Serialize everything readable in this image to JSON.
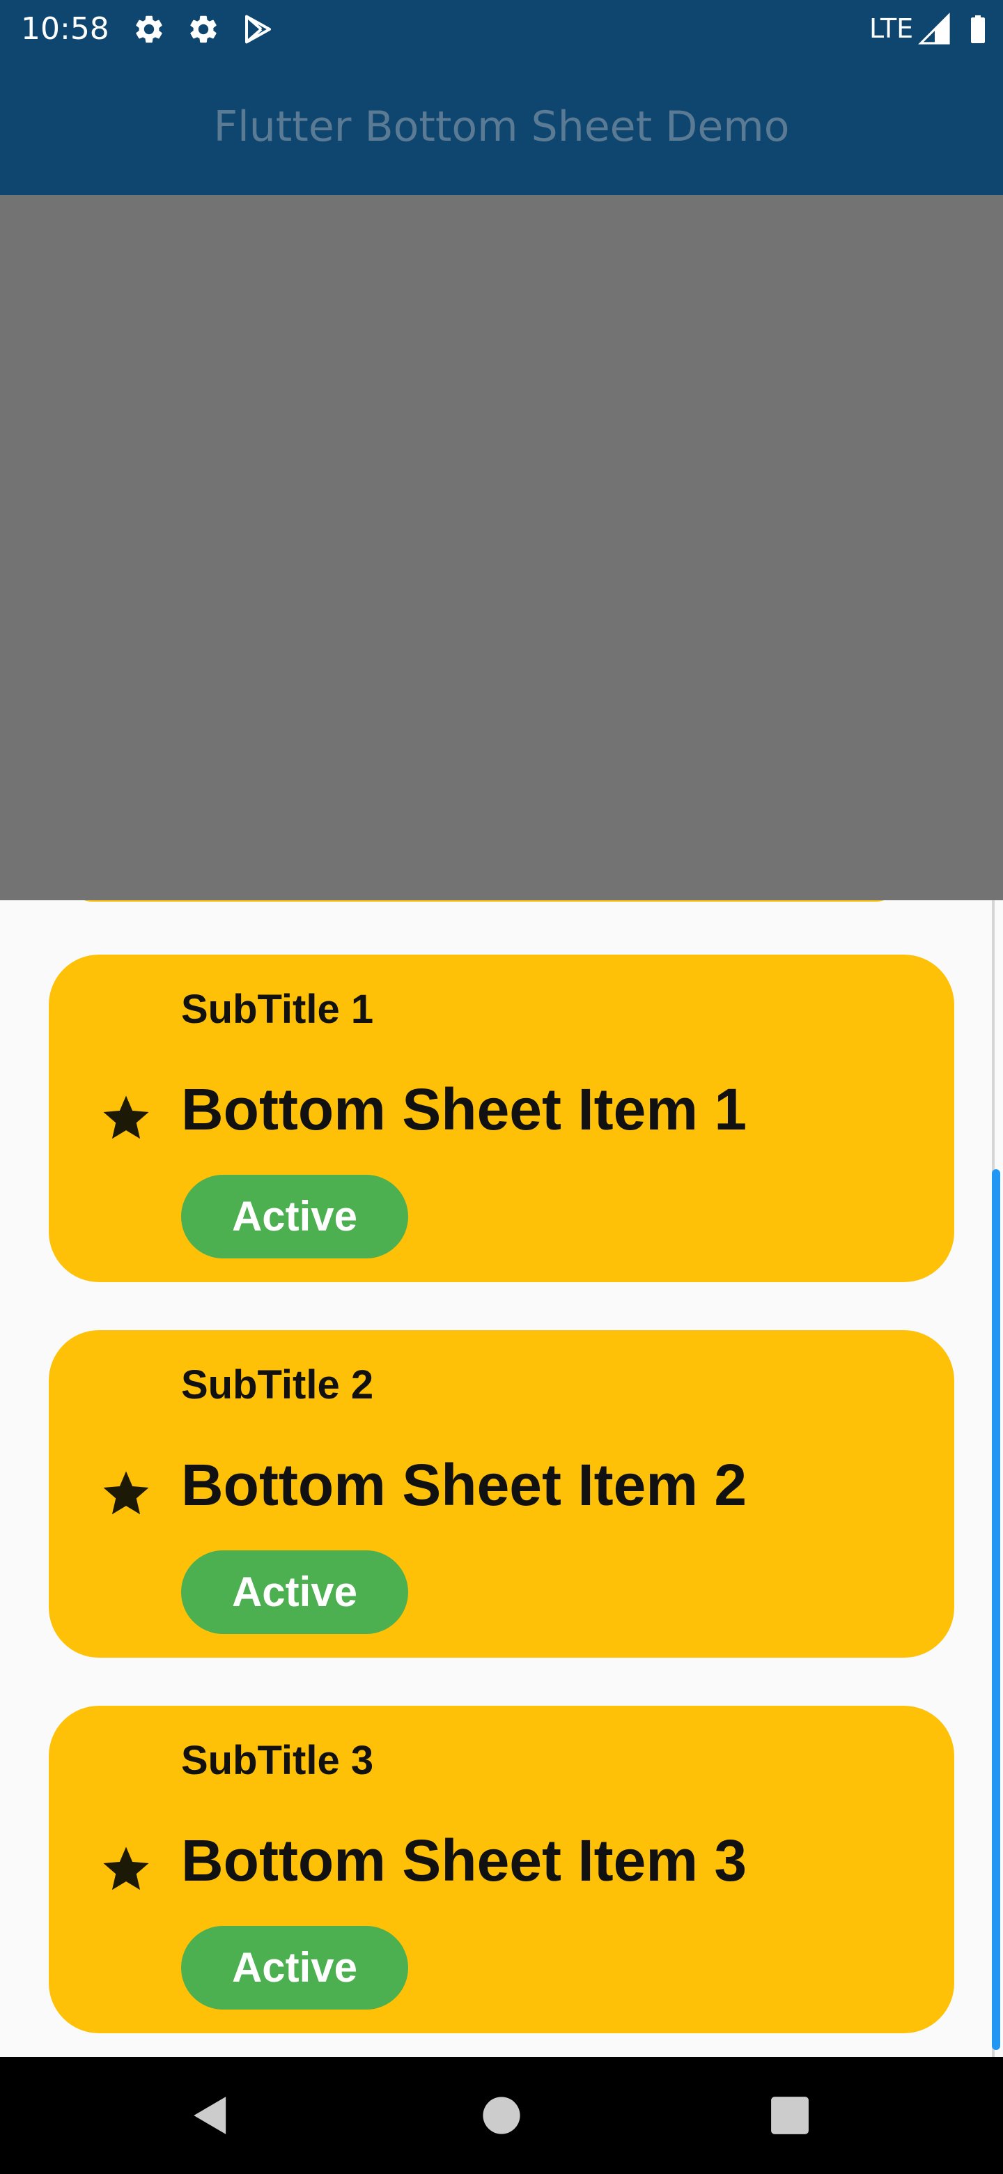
{
  "status_bar": {
    "time": "10:58",
    "network_label": "LTE",
    "icons": [
      "settings-gear-icon",
      "settings-gear-icon",
      "play-store-icon",
      "cell-signal-icon",
      "battery-icon"
    ]
  },
  "app_bar": {
    "title": "Flutter Bottom Sheet Demo"
  },
  "bottom_sheet": {
    "items": [
      {
        "subtitle": "SubTitle 1",
        "title": "Bottom Sheet Item 1",
        "status": "Active",
        "icon": "star-icon"
      },
      {
        "subtitle": "SubTitle 2",
        "title": "Bottom Sheet Item 2",
        "status": "Active",
        "icon": "star-icon"
      },
      {
        "subtitle": "SubTitle 3",
        "title": "Bottom Sheet Item 3",
        "status": "Active",
        "icon": "star-icon"
      }
    ]
  },
  "nav_bar": {
    "buttons": [
      "back-icon",
      "home-icon",
      "recents-icon"
    ]
  },
  "colors": {
    "app_bar": "#0e4670",
    "scrim": "#737373",
    "card": "#fec107",
    "badge": "#4caf50",
    "scrollbar_thumb": "#2196f3",
    "nav_bar": "#000000"
  }
}
